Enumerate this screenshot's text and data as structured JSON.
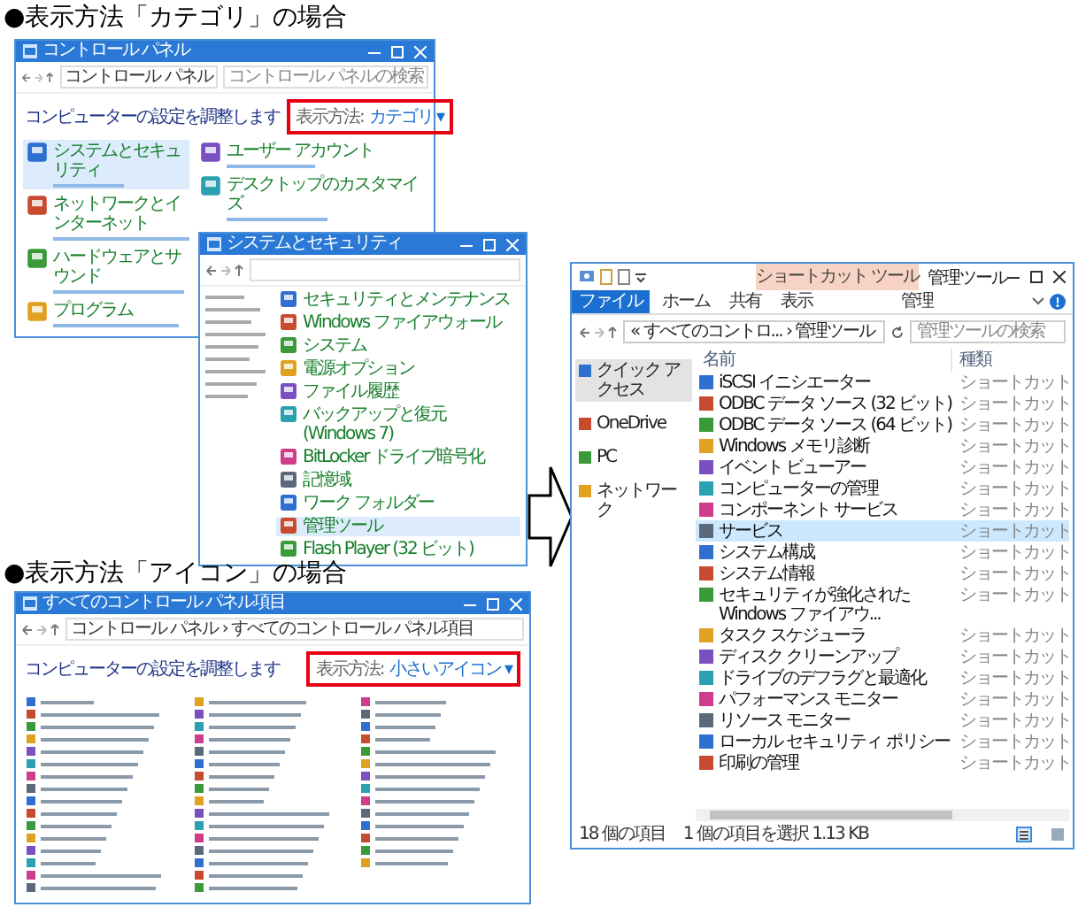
{
  "category_section": {
    "heading": "●表示方法「カテゴリ」の場合",
    "control_panel_window": {
      "title": "コントロール パネル",
      "address": "コントロール パネル",
      "search_placeholder": "コントロール パネルの検索",
      "heading": "コンピューターの設定を調整します",
      "view_label": "表示方法:",
      "view_value": "カテゴリ ▾",
      "categories_left": [
        {
          "name": "システムとセキュリティ",
          "selected": true
        },
        {
          "name": "ネットワークとインターネット",
          "selected": false
        },
        {
          "name": "ハードウェアとサウンド",
          "selected": false
        },
        {
          "name": "プログラム",
          "selected": false
        }
      ],
      "categories_right": [
        {
          "name": "ユーザー アカウント",
          "selected": false
        },
        {
          "name": "デスクトップのカスタマイズ",
          "selected": false
        }
      ]
    },
    "system_window": {
      "title": "システムとセキュリティ",
      "items": [
        {
          "name": "セキュリティとメンテナンス",
          "selected": false
        },
        {
          "name": "Windows ファイアウォール",
          "selected": false
        },
        {
          "name": "システム",
          "selected": false
        },
        {
          "name": "電源オプション",
          "selected": false
        },
        {
          "name": "ファイル履歴",
          "selected": false
        },
        {
          "name": "バックアップと復元 (Windows 7)",
          "selected": false
        },
        {
          "name": "BitLocker ドライブ暗号化",
          "selected": false
        },
        {
          "name": "記憶域",
          "selected": false
        },
        {
          "name": "ワーク フォルダー",
          "selected": false
        },
        {
          "name": "管理ツール",
          "selected": true
        },
        {
          "name": "Flash Player (32 ビット)",
          "selected": false
        }
      ]
    }
  },
  "icon_section": {
    "heading": "●表示方法「アイコン」の場合",
    "window": {
      "title": "すべてのコントロール パネル項目",
      "address": "コントロール パネル › すべてのコントロール パネル項目",
      "heading": "コンピューターの設定を調整します",
      "view_label": "表示方法:",
      "view_value": "小さいアイコン ▾"
    }
  },
  "explorer": {
    "context_tab": "ショートカット ツール",
    "title": "管理ツール",
    "ribbon_tabs": [
      {
        "label": "ファイル",
        "kind": "file"
      },
      {
        "label": "ホーム",
        "kind": "plain"
      },
      {
        "label": "共有",
        "kind": "plain"
      },
      {
        "label": "表示",
        "kind": "plain"
      },
      {
        "label": "管理",
        "kind": "context"
      }
    ],
    "address": "« すべてのコントロ... › 管理ツール",
    "search_placeholder": "管理ツールの検索",
    "nav": [
      {
        "label": "クイック アクセス",
        "selected": true
      },
      {
        "label": "OneDrive",
        "selected": false
      },
      {
        "label": "PC",
        "selected": false
      },
      {
        "label": "ネットワーク",
        "selected": false
      }
    ],
    "columns": [
      "名前",
      "種類"
    ],
    "rows": [
      {
        "name": "iSCSI イニシエーター",
        "type": "ショートカット",
        "selected": false
      },
      {
        "name": "ODBC データ ソース (32 ビット)",
        "type": "ショートカット",
        "selected": false
      },
      {
        "name": "ODBC データ ソース (64 ビット)",
        "type": "ショートカット",
        "selected": false
      },
      {
        "name": "Windows メモリ診断",
        "type": "ショートカット",
        "selected": false
      },
      {
        "name": "イベント ビューアー",
        "type": "ショートカット",
        "selected": false
      },
      {
        "name": "コンピューターの管理",
        "type": "ショートカット",
        "selected": false
      },
      {
        "name": "コンポーネント サービス",
        "type": "ショートカット",
        "selected": false
      },
      {
        "name": "サービス",
        "type": "ショートカット",
        "selected": true
      },
      {
        "name": "システム構成",
        "type": "ショートカット",
        "selected": false
      },
      {
        "name": "システム情報",
        "type": "ショートカット",
        "selected": false
      },
      {
        "name": "セキュリティが強化された Windows ファイアウ...",
        "type": "ショートカット",
        "selected": false
      },
      {
        "name": "タスク スケジューラ",
        "type": "ショートカット",
        "selected": false
      },
      {
        "name": "ディスク クリーンアップ",
        "type": "ショートカット",
        "selected": false
      },
      {
        "name": "ドライブのデフラグと最適化",
        "type": "ショートカット",
        "selected": false
      },
      {
        "name": "パフォーマンス モニター",
        "type": "ショートカット",
        "selected": false
      },
      {
        "name": "リソース モニター",
        "type": "ショートカット",
        "selected": false
      },
      {
        "name": "ローカル セキュリティ ポリシー",
        "type": "ショートカット",
        "selected": false
      },
      {
        "name": "印刷の管理",
        "type": "ショートカット",
        "selected": false
      }
    ],
    "status": {
      "count": "18 個の項目",
      "selection": "1 個の項目を選択  1.13 KB"
    }
  }
}
